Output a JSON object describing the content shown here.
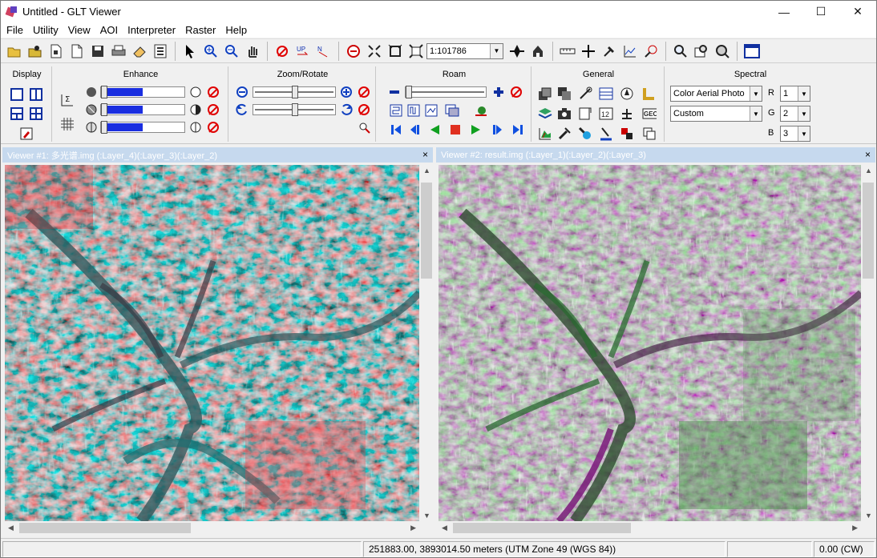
{
  "window": {
    "title": "Untitled - GLT Viewer",
    "minimize": "—",
    "maximize": "☐",
    "close": "✕"
  },
  "menu": [
    "File",
    "Utility",
    "View",
    "AOI",
    "Interpreter",
    "Raster",
    "Help"
  ],
  "toolbar": {
    "scale_value": "1:101786"
  },
  "panels": {
    "display": {
      "title": "Display"
    },
    "enhance": {
      "title": "Enhance",
      "slider_fill_percent": [
        50,
        50,
        50
      ]
    },
    "zoom_rotate": {
      "title": "Zoom/Rotate"
    },
    "roam": {
      "title": "Roam"
    },
    "general": {
      "title": "General",
      "geo_label": "GEO",
      "num_label": "12"
    },
    "spectral": {
      "title": "Spectral",
      "preset_value": "Color Aerial Photo",
      "mode_value": "Custom",
      "r_label": "R",
      "r_value": "1",
      "g_label": "G",
      "g_value": "2",
      "b_label": "B",
      "b_value": "3"
    }
  },
  "viewers": [
    {
      "title": "Viewer #1: 多光谱.img (:Layer_4)(:Layer_3)(:Layer_2)",
      "close": "×"
    },
    {
      "title": "Viewer #2: result.img (:Layer_1)(:Layer_2)(:Layer_3)",
      "close": "×"
    }
  ],
  "status": {
    "coords": "251883.00, 3893014.50 meters (UTM Zone 49 (WGS 84))",
    "rotation": "0.00 (CW)"
  },
  "colors": {
    "viewer1_red": "#f0303c",
    "viewer1_cyan": "#8ee6e6",
    "viewer2_green": "#4a8a4a",
    "viewer2_purple": "#6a2a6a",
    "viewer_title_bg": "#c6d9ee"
  }
}
